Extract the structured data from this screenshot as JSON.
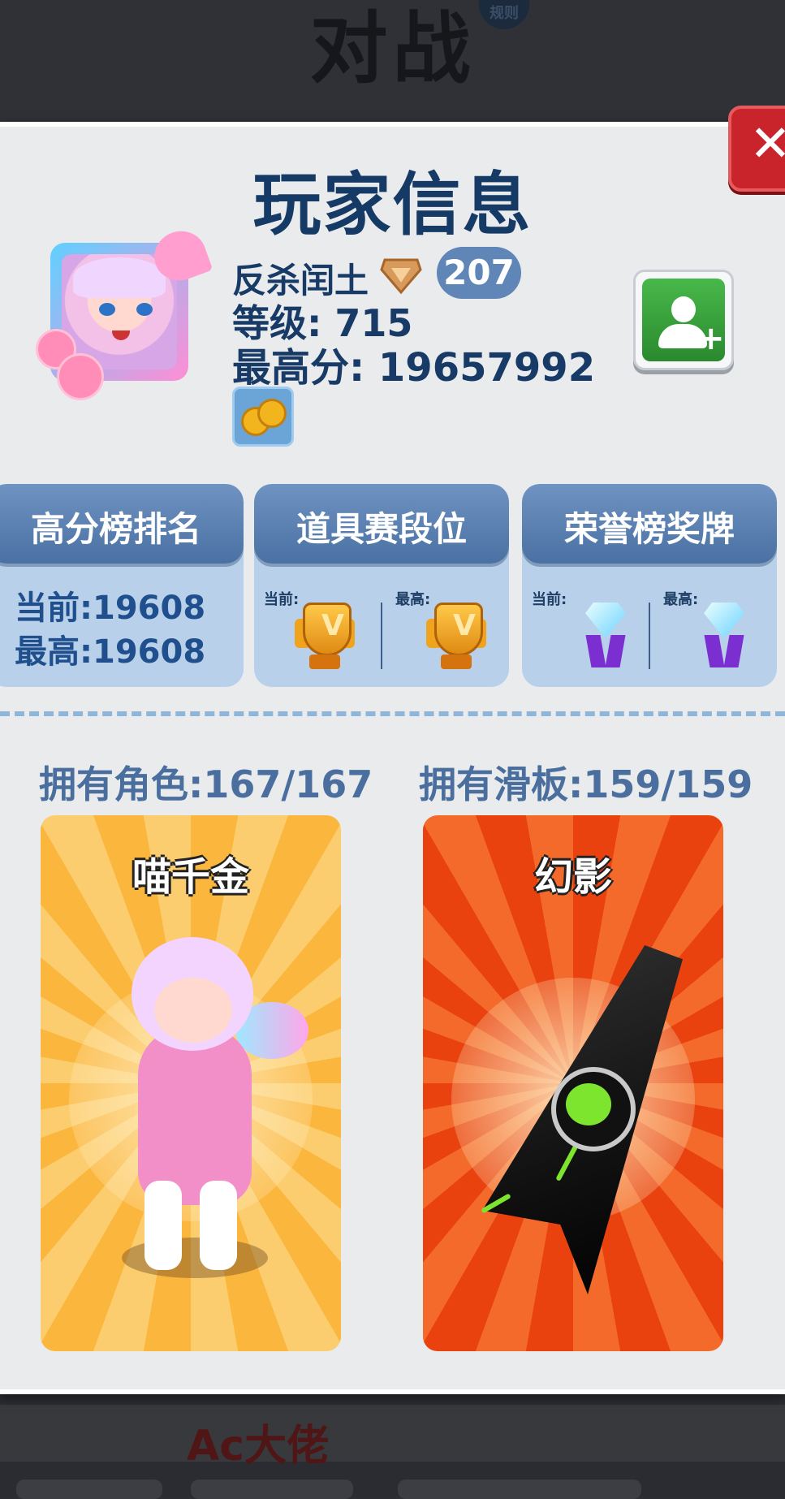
{
  "background": {
    "top_title": "对战",
    "rules_badge": "规则",
    "banner_text": "Ac大佬"
  },
  "panel": {
    "title": "玩家信息",
    "close_label": "✕"
  },
  "player": {
    "name": "反杀闰土",
    "rank_number": "207",
    "level": "等级: 715",
    "high_score": "最高分: 19657992"
  },
  "stats": {
    "leaderboard": {
      "label": "高分榜排名",
      "current": "当前:19608",
      "highest": "最高:19608"
    },
    "item_tier": {
      "label": "道具赛段位",
      "current_label": "当前:",
      "highest_label": "最高:"
    },
    "honor_medal": {
      "label": "荣誉榜奖牌",
      "current_label": "当前:",
      "highest_label": "最高:"
    }
  },
  "collection": {
    "characters_owned": "拥有角色:167/167",
    "boards_owned": "拥有滑板:159/159",
    "character_name": "喵千金",
    "board_name": "幻影"
  },
  "icons": {
    "close": "close-icon",
    "rank": "diamond-rank-icon",
    "coins": "coins-icon",
    "add_friend": "add-friend-icon",
    "trophy": "trophy-icon",
    "medal": "diamond-medal-icon"
  },
  "colors": {
    "title": "#153a66",
    "stat_header": "#5a80b2",
    "stat_card": "#b9d0ea",
    "close": "#c9242b",
    "add_friend": "#3aa33c",
    "character_card": "#fbb63e",
    "board_card": "#e9420f"
  }
}
